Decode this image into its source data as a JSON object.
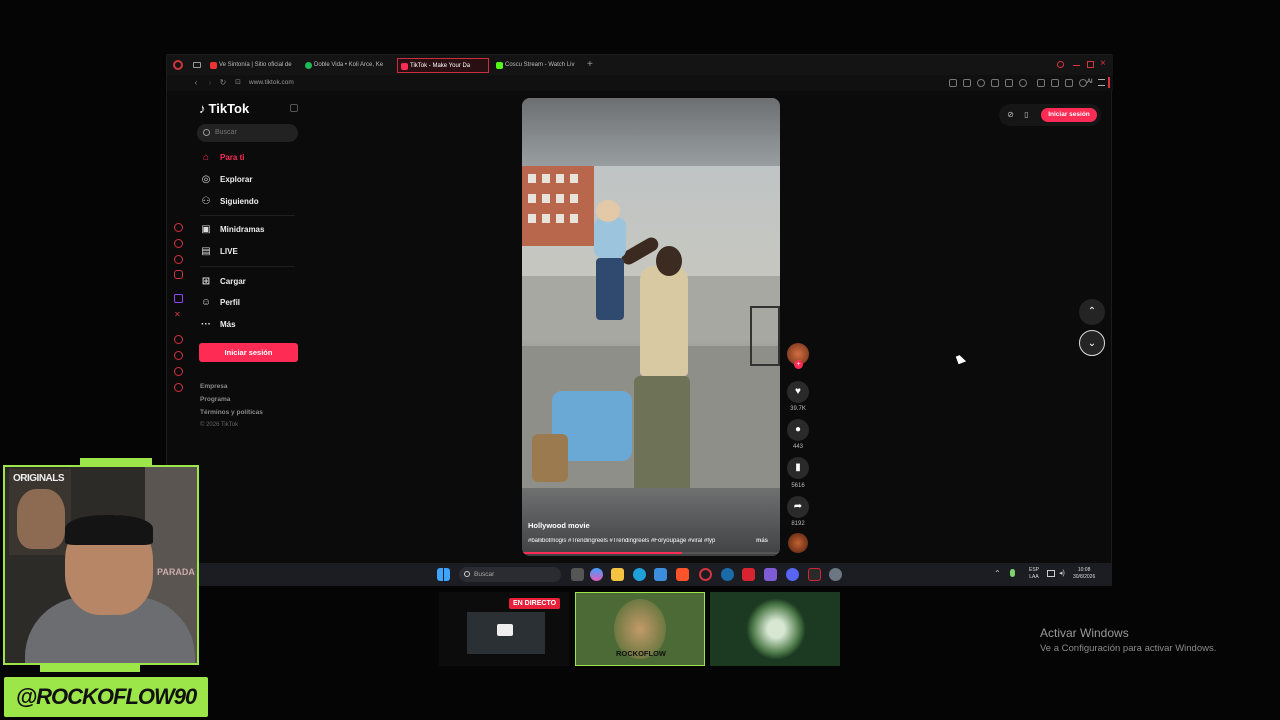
{
  "browser": {
    "tabs": [
      {
        "label": "Ve Sintonía | Sitio oficial de",
        "favicon": "#e33"
      },
      {
        "label": "Doble Vida • Koli Arce, Ke",
        "favicon": "#1db954"
      },
      {
        "label": "TikTok - Make Your Da",
        "favicon": "#fe2c55",
        "active": true
      },
      {
        "label": "Coscu Stream - Watch Liv",
        "favicon": "#53fc18"
      }
    ],
    "url": "www.tiktok.com",
    "ai_label": "AI"
  },
  "tiktok": {
    "logo": "TikTok",
    "search_placeholder": "Buscar",
    "nav": [
      {
        "label": "Para ti",
        "icon": "home-icon",
        "active": true
      },
      {
        "label": "Explorar",
        "icon": "compass-icon"
      },
      {
        "label": "Siguiendo",
        "icon": "following-icon"
      },
      {
        "label": "Minidramas",
        "icon": "film-icon"
      },
      {
        "label": "LIVE",
        "icon": "live-icon"
      },
      {
        "label": "Cargar",
        "icon": "upload-icon"
      },
      {
        "label": "Perfil",
        "icon": "profile-icon"
      },
      {
        "label": "Más",
        "icon": "more-icon"
      }
    ],
    "login_button": "Iniciar sesión",
    "footer": [
      "Empresa",
      "Programa",
      "Términos y políticas"
    ],
    "copyright": "© 2026 TikTok",
    "top_login": "Iniciar sesión"
  },
  "video": {
    "title": "Hollywood movie",
    "hashtags": "#ballibotmogis #Trendingreels #Trendingreels #Foryoupage #viral #fyp",
    "more": "más",
    "progress": 0.62,
    "likes": "39.7K",
    "comments": "443",
    "saves": "5616",
    "shares": "8192"
  },
  "taskbar": {
    "search_placeholder": "Buscar",
    "lang": "ESP",
    "lang_sub": "LAA",
    "time": "10:08",
    "date": "30/8/2026"
  },
  "overlay": {
    "poster_text": "ORIGINALS",
    "wall_sign": "PARADA",
    "handle": "@ROCKOFLOW90",
    "live_badge": "EN DIRECTO",
    "panel_name": "ROCKOFLOW"
  },
  "windows": {
    "activate_title": "Activar Windows",
    "activate_sub": "Ve a Configuración para activar Windows."
  },
  "colors": {
    "accent": "#fe2c55",
    "overlay_green": "#9de64a",
    "opera_red": "#d3343f"
  }
}
